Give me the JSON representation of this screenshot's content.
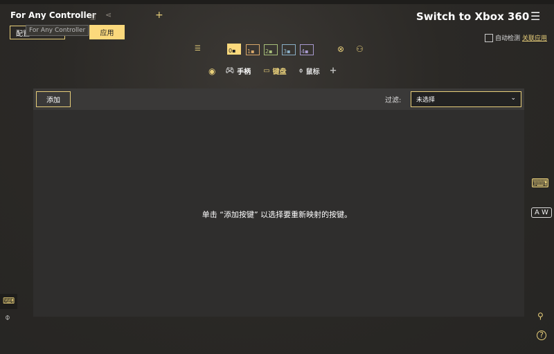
{
  "app": {
    "profile_title": "For Any Controller",
    "tooltip": "For Any Controller",
    "config_label": "配置",
    "apply_label": "应用"
  },
  "header": {
    "switch_title": "Switch to Xbox 360",
    "auto_detect_label": "自动检测",
    "link_apps_label": "关联应用"
  },
  "slots": [
    "0",
    "1",
    "2",
    "3",
    "4"
  ],
  "tabs": {
    "gamepad": "手柄",
    "keyboard": "键盘",
    "mouse": "鼠标"
  },
  "toolbar": {
    "add_label": "添加",
    "filter_label": "过滤:",
    "filter_value": "未选择"
  },
  "main": {
    "empty_message": "单击 “添加按键” 以选择要重新映射的按键。"
  },
  "colors": {
    "accent": "#fbd97c"
  }
}
